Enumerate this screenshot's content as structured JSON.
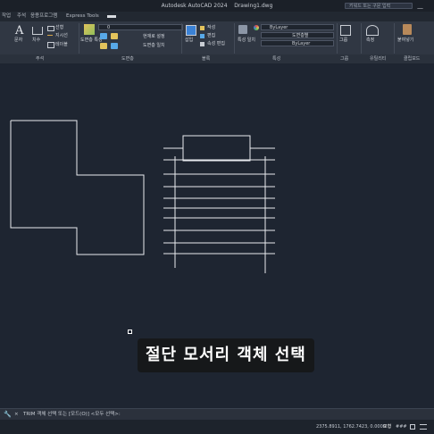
{
  "titlebar": {
    "app_title": "Autodesk AutoCAD 2024",
    "document_title": "Drawing1.dwg",
    "search_placeholder": "키워드 또는 구문 입력",
    "minimize_glyph": "—"
  },
  "ribbon_tabs": [
    {
      "label": "작업",
      "active": false
    },
    {
      "label": "주석",
      "active": false
    },
    {
      "label": "응용프로그램",
      "active": false
    },
    {
      "label": "Express Tools",
      "active": false
    }
  ],
  "ribbon": {
    "draw_panel": {
      "large_tools": [
        "문자",
        "치수"
      ],
      "small_tools": [
        "선형",
        "지시선",
        "테이블"
      ]
    },
    "modify_panel": {
      "large_tool": "도면층 특성",
      "layer_dropdown": "0",
      "small_tools": [
        "현재로 설정",
        "도면층 일치"
      ]
    },
    "block_panel": {
      "large_tool": "삽입",
      "small_tools": [
        "작성",
        "편집",
        "속성 편집"
      ]
    },
    "properties_panel": {
      "large_tool": "특성 일치",
      "color_dropdown": "ByLayer",
      "linetype_dropdown": "도면층별",
      "lineweight_dropdown": "ByLayer"
    },
    "groups_panel": {
      "large_tool": "그룹"
    },
    "utilities_panel": {
      "large_tool": "측정"
    },
    "clipboard_panel": {
      "large_tool": "붙여넣기"
    }
  },
  "panel_footer": [
    "주석",
    "도면층",
    "블록",
    "특성",
    "그룹",
    "유틸리티",
    "클립보드"
  ],
  "subtitle": "절단 모서리 객체 선택",
  "command_line": {
    "prompt": "TRIM 객체 선택 또는 [모드(O)] <모두 선택>:",
    "close_glyph": "×"
  },
  "statusbar": {
    "coordinates": "2375.8911, 1762.7423, 0.0000",
    "model_label": "모형",
    "grid_glyph": "###"
  },
  "colors": {
    "canvas": "#1e2531",
    "ribbon": "#303743",
    "drawing_lines": "#e9ecf0",
    "accent_blue": "#3b82d6"
  }
}
